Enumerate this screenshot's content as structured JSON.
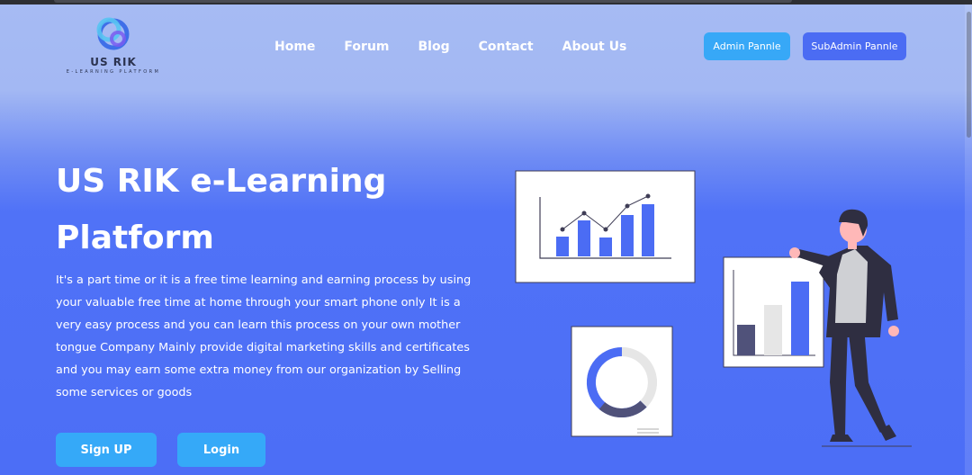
{
  "brand": {
    "name": "US RIK",
    "tagline": "E-LEARNING PLATFORM"
  },
  "nav": {
    "items": [
      {
        "label": "Home"
      },
      {
        "label": "Forum"
      },
      {
        "label": "Blog"
      },
      {
        "label": "Contact"
      },
      {
        "label": "About Us"
      }
    ]
  },
  "header_buttons": {
    "admin": "Admin Pannle",
    "subadmin": "SubAdmin Pannle"
  },
  "hero": {
    "title": "US RIK e-Learning Platform",
    "description": "It's a part time or it is a free time learning and earning process by using your valuable free time at home through your smart phone only It is a very easy process and you can learn this process on your own mother tongue Company Mainly provide digital marketing skills and certificates and you may earn some extra money from our organization by Selling some services or goods",
    "signup_label": "Sign UP",
    "login_label": "Login"
  },
  "colors": {
    "accent_light": "#37a8f7",
    "accent_dark": "#4b6cf3",
    "illustration_blue": "#4b6cf4",
    "figure_dark": "#2f2e41"
  },
  "icons": {
    "logo": "ring-logo-icon",
    "illustration": "analytics-presenter-illustration"
  }
}
